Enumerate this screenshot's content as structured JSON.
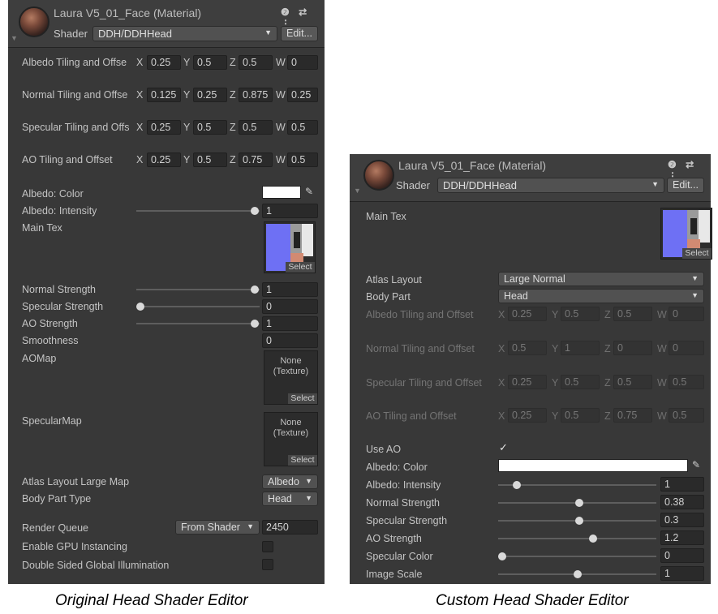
{
  "left": {
    "header": {
      "title": "Laura V5_01_Face (Material)",
      "icons": "❷ ⇄ ⋮",
      "shader_label": "Shader",
      "shader_value": "DDH/DDHHead",
      "edit_label": "Edit..."
    },
    "vec_rows": [
      {
        "label": "Albedo Tiling and Offse",
        "x": "0.25",
        "y": "0.5",
        "z": "0.5",
        "w": "0"
      },
      {
        "label": "Normal Tiling and Offse",
        "x": "0.125",
        "y": "0.25",
        "z": "0.875",
        "w": "0.25"
      },
      {
        "label": "Specular Tiling and Offs",
        "x": "0.25",
        "y": "0.5",
        "z": "0.5",
        "w": "0.5"
      },
      {
        "label": "AO Tiling and Offset",
        "x": "0.25",
        "y": "0.5",
        "z": "0.75",
        "w": "0.5"
      }
    ],
    "albedo_color": "Albedo: Color",
    "albedo_intensity": {
      "label": "Albedo: Intensity",
      "value": "1",
      "level": 1.0
    },
    "main_tex": "Main Tex",
    "select": "Select",
    "normal_strength": {
      "label": "Normal Strength",
      "value": "1",
      "level": 1.0
    },
    "specular_strength": {
      "label": "Specular Strength",
      "value": "0",
      "level": 0.0
    },
    "ao_strength": {
      "label": "AO Strength",
      "value": "1",
      "level": 1.0
    },
    "smoothness": {
      "label": "Smoothness",
      "value": "0"
    },
    "aomap": "AOMap",
    "specularmap": "SpecularMap",
    "none_texture": "None\n(Texture)",
    "atlas_layout": {
      "label": "Atlas Layout Large Map",
      "value": "Albedo"
    },
    "body_part": {
      "label": "Body Part Type",
      "value": "Head"
    },
    "render_queue": {
      "label": "Render Queue",
      "dropdown": "From Shader",
      "value": "2450"
    },
    "gpu_instancing": "Enable GPU Instancing",
    "double_sided": "Double Sided Global Illumination"
  },
  "right": {
    "header": {
      "title": "Laura V5_01_Face (Material)",
      "icons": "❷ ⇄ ⋮",
      "shader_label": "Shader",
      "shader_value": "DDH/DDHHead",
      "edit_label": "Edit..."
    },
    "main_tex": "Main Tex",
    "select": "Select",
    "atlas_layout": {
      "label": "Atlas Layout",
      "value": "Large Normal"
    },
    "body_part": {
      "label": "Body Part",
      "value": "Head"
    },
    "vec_rows": [
      {
        "label": "Albedo Tiling and Offset",
        "x": "0.25",
        "y": "0.5",
        "z": "0.5",
        "w": "0"
      },
      {
        "label": "Normal Tiling and Offset",
        "x": "0.5",
        "y": "1",
        "z": "0",
        "w": "0"
      },
      {
        "label": "Specular Tiling and Offset",
        "x": "0.25",
        "y": "0.5",
        "z": "0.5",
        "w": "0.5"
      },
      {
        "label": "AO Tiling and Offset",
        "x": "0.25",
        "y": "0.5",
        "z": "0.75",
        "w": "0.5"
      }
    ],
    "use_ao": {
      "label": "Use AO",
      "checked": "✓"
    },
    "albedo_color": "Albedo: Color",
    "sliders": [
      {
        "label": "Albedo: Intensity",
        "value": "1",
        "level": 0.1
      },
      {
        "label": "Normal Strength",
        "value": "0.38",
        "level": 0.5
      },
      {
        "label": "Specular Strength",
        "value": "0.3",
        "level": 0.5
      },
      {
        "label": "AO Strength",
        "value": "1.2",
        "level": 0.6
      },
      {
        "label": "Specular Color",
        "value": "0",
        "level": 0.0
      },
      {
        "label": "Image Scale",
        "value": "1",
        "level": 0.5
      }
    ]
  },
  "captions": {
    "left": "Original Head Shader Editor",
    "right": "Custom Head Shader Editor"
  }
}
